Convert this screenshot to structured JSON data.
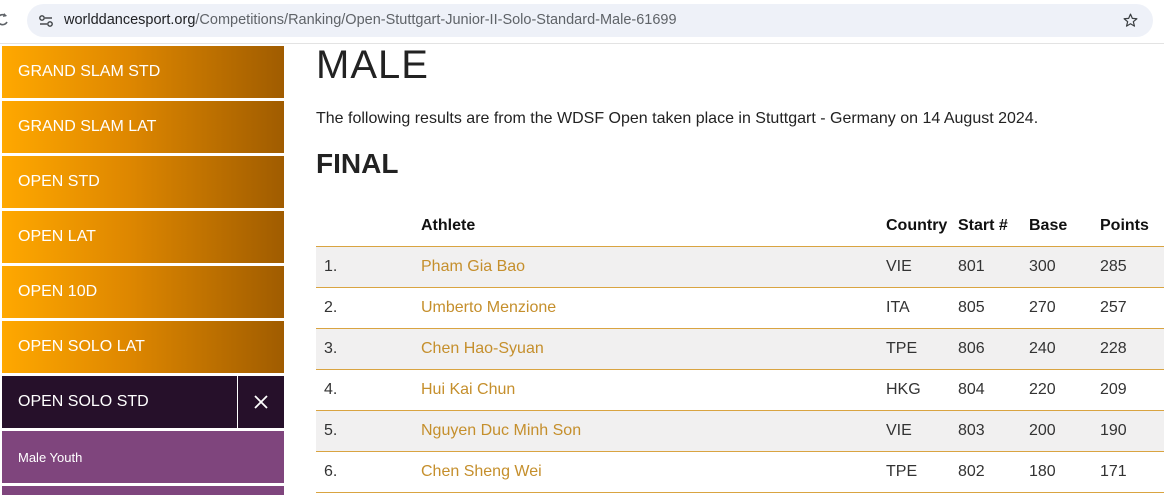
{
  "browser": {
    "url_host": "worlddancesport.org",
    "url_path": "/Competitions/Ranking/Open-Stuttgart-Junior-II-Solo-Standard-Male-61699"
  },
  "sidebar": {
    "items": [
      {
        "label": "GRAND SLAM STD"
      },
      {
        "label": "GRAND SLAM LAT"
      },
      {
        "label": "OPEN STD"
      },
      {
        "label": "OPEN LAT"
      },
      {
        "label": "OPEN 10D"
      },
      {
        "label": "OPEN SOLO LAT"
      },
      {
        "label": "OPEN SOLO STD"
      }
    ],
    "sub_items": [
      {
        "label": "Male Youth"
      }
    ]
  },
  "main": {
    "title": "MALE",
    "intro": "The following results are from the WDSF Open taken place in Stuttgart - Germany on 14 August 2024.",
    "section_title": "FINAL",
    "table": {
      "headers": [
        "",
        "Athlete",
        "Country",
        "Start #",
        "Base",
        "Points"
      ],
      "rows": [
        {
          "rank": "1.",
          "athlete": "Pham Gia Bao",
          "country": "VIE",
          "start": "801",
          "base": "300",
          "points": "285"
        },
        {
          "rank": "2.",
          "athlete": "Umberto Menzione",
          "country": "ITA",
          "start": "805",
          "base": "270",
          "points": "257"
        },
        {
          "rank": "3.",
          "athlete": "Chen Hao-Syuan",
          "country": "TPE",
          "start": "806",
          "base": "240",
          "points": "228"
        },
        {
          "rank": "4.",
          "athlete": "Hui Kai Chun",
          "country": "HKG",
          "start": "804",
          "base": "220",
          "points": "209"
        },
        {
          "rank": "5.",
          "athlete": "Nguyen Duc Minh Son",
          "country": "VIE",
          "start": "803",
          "base": "200",
          "points": "190"
        },
        {
          "rank": "6.",
          "athlete": "Chen Sheng Wei",
          "country": "TPE",
          "start": "802",
          "base": "180",
          "points": "171"
        }
      ]
    }
  },
  "colors": {
    "accent_gold": "#de8700",
    "active_dark": "#26102a",
    "sub_purple": "#7f457d",
    "link": "#c58f2c"
  }
}
